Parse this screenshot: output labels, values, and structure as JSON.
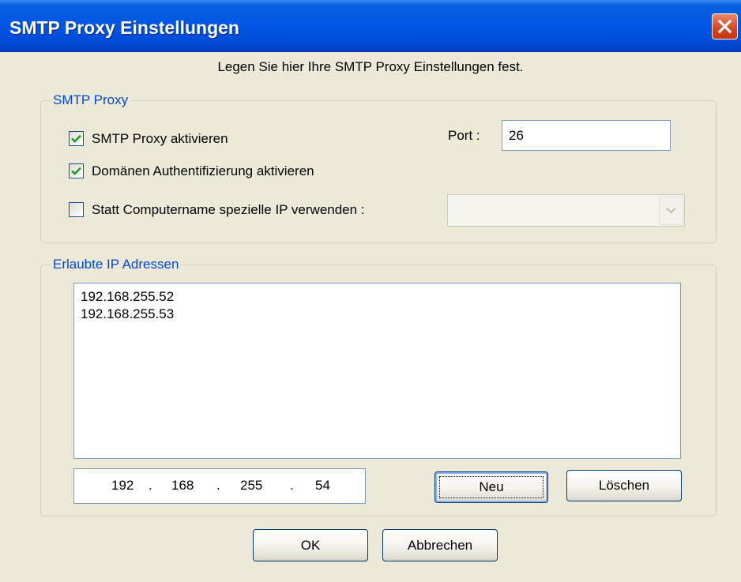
{
  "window": {
    "title": "SMTP Proxy Einstellungen"
  },
  "subtitle": "Legen Sie hier Ihre SMTP Proxy Einstellungen fest.",
  "smtp_group": {
    "legend": "SMTP Proxy",
    "enable_proxy": {
      "label": "SMTP Proxy aktivieren",
      "checked": true
    },
    "domain_auth": {
      "label": "Domänen Authentifizierung aktivieren",
      "checked": true
    },
    "special_ip": {
      "label": "Statt Computername spezielle IP verwenden :",
      "checked": false
    },
    "port": {
      "label": "Port :",
      "value": "26"
    },
    "ip_combo": {
      "value": ""
    }
  },
  "ip_group": {
    "legend": "Erlaubte IP Adressen",
    "addresses": [
      "192.168.255.52",
      "192.168.255.53"
    ],
    "ip_input": {
      "oct1": "192",
      "oct2": "168",
      "oct3": "255",
      "oct4": "54"
    },
    "new_label": "Neu",
    "delete_label": "Löschen"
  },
  "buttons": {
    "ok": "OK",
    "cancel": "Abbrechen"
  },
  "colors": {
    "titlebar": "#0055E5",
    "legend": "#0046D5",
    "dialog_bg": "#ECE9D8",
    "close": "#D2461F"
  }
}
